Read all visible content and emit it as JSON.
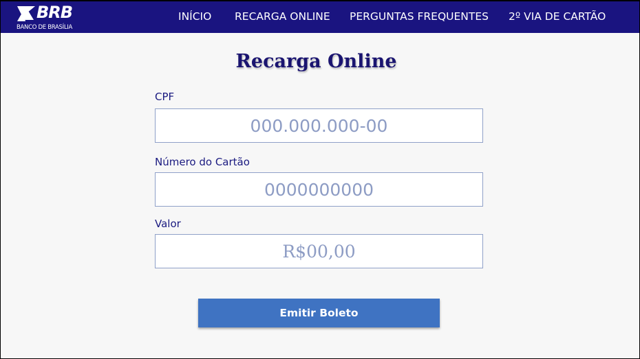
{
  "brand": {
    "logo_text": "BRB",
    "logo_subtitle": "BANCO DE BRASÍLIA",
    "logo_icon": "brb-logo-icon"
  },
  "nav": {
    "items": [
      {
        "label": "INÍCIO"
      },
      {
        "label": "RECARGA ONLINE"
      },
      {
        "label": "PERGUNTAS FREQUENTES"
      },
      {
        "label": "2º VIA DE CARTÃO"
      }
    ]
  },
  "main": {
    "title": "Recarga Online",
    "fields": {
      "cpf": {
        "label": "CPF",
        "value": "",
        "placeholder": "000.000.000-00"
      },
      "cartao": {
        "label": "Número do Cartão",
        "value": "",
        "placeholder": "0000000000"
      },
      "valor": {
        "label": "Valor",
        "value": "",
        "placeholder": "R$00,00"
      }
    },
    "submit_label": "Emitir Boleto"
  },
  "colors": {
    "navbar": "#1a1480",
    "title": "#1a1470",
    "button": "#3f73c2",
    "background": "#f7f7f7"
  }
}
